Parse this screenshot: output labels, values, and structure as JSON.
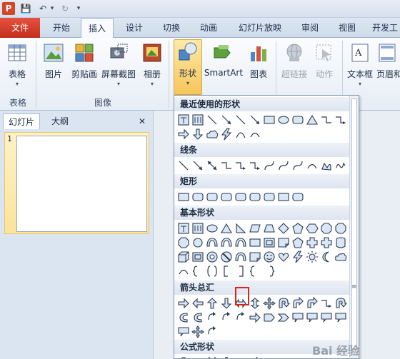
{
  "qat": {
    "items": [
      "P",
      "💾",
      "↶",
      "▾",
      "↻",
      "▾"
    ]
  },
  "tabs": [
    {
      "label": "文件"
    },
    {
      "label": "开始"
    },
    {
      "label": "插入"
    },
    {
      "label": "设计"
    },
    {
      "label": "切换"
    },
    {
      "label": "动画"
    },
    {
      "label": "幻灯片放映"
    },
    {
      "label": "审阅"
    },
    {
      "label": "视图"
    },
    {
      "label": "开发工"
    }
  ],
  "ribbon": {
    "table_label": "表格",
    "table_group": "表格",
    "picture_label": "图片",
    "clipart_label": "剪贴画",
    "screenshot_label": "屏幕截图",
    "album_label": "相册",
    "image_group": "图像",
    "shapes_label": "形状",
    "smartart_label": "SmartArt",
    "chart_label": "图表",
    "hyperlink_label": "超链接",
    "action_label": "动作",
    "textbox_label": "文本框",
    "header_label": "页眉和"
  },
  "pane": {
    "tab_slides": "幻灯片",
    "tab_outline": "大纲",
    "close": "✕",
    "slide_number": "1"
  },
  "dropdown": {
    "sections": [
      "最近使用的形状",
      "线条",
      "矩形",
      "基本形状",
      "箭头总汇",
      "公式形状"
    ],
    "scroll_grip": "≡"
  },
  "watermark": "Bai 经验"
}
